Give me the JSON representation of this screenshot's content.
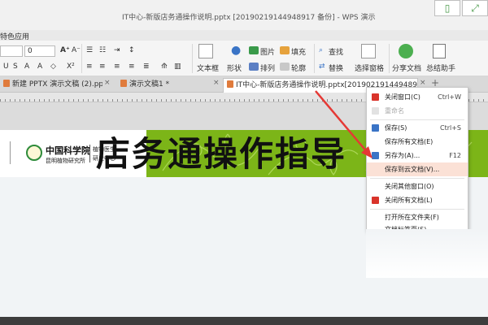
{
  "window": {
    "title": "IT中心-新版店务通操作说明.pptx [20190219144948917 备份] - WPS 演示",
    "corner_left_glyph": "▯",
    "corner_right_glyph": "⤢"
  },
  "menubar": {
    "partial_label": "特色应用"
  },
  "ribbon": {
    "font_size_value": "0",
    "text_box_label": "文本框",
    "shapes_label": "形状",
    "picture_label": "图片",
    "fill_label": "填充",
    "arrange_label": "排列",
    "outline_label": "轮廓",
    "find_label": "查找",
    "replace_label": "替换",
    "select_pane_label": "选择窗格",
    "share_label": "分享文档",
    "summary_label": "总结助手"
  },
  "tabs": [
    {
      "label": "新建 PPTX 演示文稿 (2).pptx *",
      "active": false
    },
    {
      "label": "演示文稿1 *",
      "active": false
    },
    {
      "label": "IT中心-新版店务通操作说明.pptx[20190219144948917 备份]",
      "active": true
    }
  ],
  "tab_add_glyph": "+",
  "slide": {
    "org_name": "中国科学院",
    "org_sub": "昆明植物研究所",
    "org_side_1": "植物医生",
    "org_side_2": "研发中心",
    "main_title": "店务通操作指导"
  },
  "context_menu": {
    "items": [
      {
        "label": "关闭窗口(C)",
        "shortcut": "Ctrl+W",
        "icon_color": "#d9342b",
        "disabled": false
      },
      {
        "label": "重命名",
        "shortcut": "",
        "icon_color": "#bbbbbb",
        "disabled": true
      },
      {
        "label": "保存(S)",
        "shortcut": "Ctrl+S",
        "icon_color": "#3a74c6",
        "disabled": false
      },
      {
        "label": "保存所有文档(E)",
        "shortcut": "",
        "icon_color": "",
        "disabled": false
      },
      {
        "label": "另存为(A)...",
        "shortcut": "F12",
        "icon_color": "#3a74c6",
        "disabled": false
      },
      {
        "label": "保存到云文档(V)...",
        "shortcut": "",
        "icon_color": "",
        "disabled": false,
        "highlighted": true
      },
      {
        "label": "关闭其他窗口(O)",
        "shortcut": "",
        "icon_color": "",
        "disabled": false
      },
      {
        "label": "关闭所有文档(L)",
        "shortcut": "",
        "icon_color": "#d9342b",
        "disabled": false
      },
      {
        "label": "打开所在文件夹(F)",
        "shortcut": "",
        "icon_color": "",
        "disabled": false
      },
      {
        "label": "文档标签页(S)",
        "shortcut": "",
        "icon_color": "",
        "disabled": false
      }
    ]
  },
  "colors": {
    "banner_green": "#7cb518",
    "menu_highlight": "#fbe1d6",
    "arrow_red": "#e53935"
  }
}
